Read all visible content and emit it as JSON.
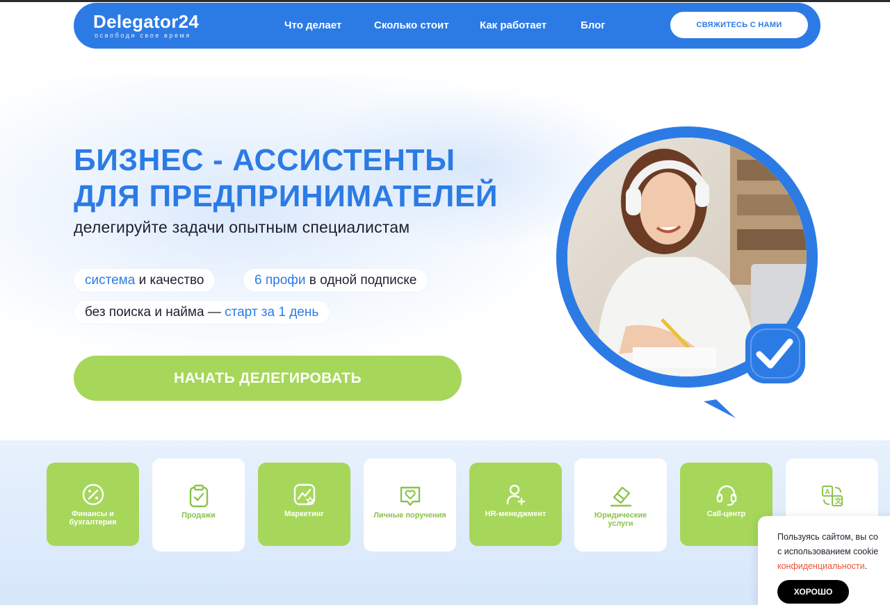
{
  "header": {
    "logo_title": "Delegator24",
    "logo_subtitle": "освободи свое время",
    "nav": [
      "Что делает",
      "Сколько стоит",
      "Как работает",
      "Блог"
    ],
    "contact_button": "СВЯЖИТЕСЬ С НАМИ"
  },
  "hero": {
    "title_line1": "БИЗНЕС - АССИСТЕНТЫ",
    "title_line2": "ДЛЯ ПРЕДПРИНИМАТЕЛЕЙ",
    "subtitle": "делегируйте задачи опытным специалистам",
    "pill1_hl": "система",
    "pill1_rest": " и качество",
    "pill2_hl": "6 профи",
    "pill2_rest": " в одной подписке",
    "pill3_rest": "без поиска и найма — ",
    "pill3_hl": "старт за 1 день",
    "cta": "НАЧАТЬ ДЕЛЕГИРОВАТЬ"
  },
  "services": [
    {
      "label": "Финансы и бухгалтерия",
      "icon": "percent-icon"
    },
    {
      "label": "Продажи",
      "icon": "clipboard-check-icon"
    },
    {
      "label": "Маркетинг",
      "icon": "chart-star-icon"
    },
    {
      "label": "Личные поручения",
      "icon": "heart-chat-icon"
    },
    {
      "label": "HR-менеджмент",
      "icon": "user-plus-icon"
    },
    {
      "label": "Юридические услуги",
      "icon": "eraser-icon"
    },
    {
      "label": "Call-центр",
      "icon": "headset-icon"
    },
    {
      "label": "",
      "icon": "translate-icon"
    }
  ],
  "cookie": {
    "line1": "Пользуясь сайтом, вы со",
    "line2": "с использованием cookie",
    "link": "конфиденциальности",
    "link_suffix": ".",
    "button": "ХОРОШО"
  },
  "colors": {
    "primary": "#2c7be5",
    "accent_green": "#a6d75b",
    "link_red": "#e8543a"
  }
}
